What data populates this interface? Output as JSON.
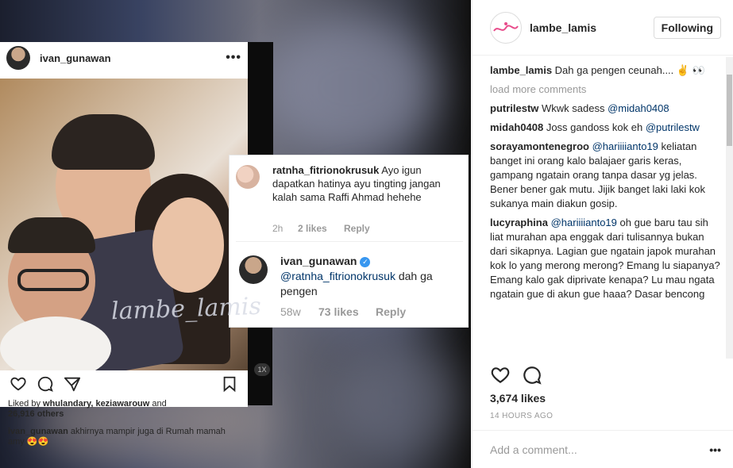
{
  "media": {
    "card": {
      "username": "ivan_gunawan",
      "more_icon": "more-dots-icon",
      "liked_by_prefix": "Liked by ",
      "liked_by_names": "whulandary, keziawarouw",
      "liked_by_and": " and",
      "liked_by_count": "26,916 others",
      "caption_user": "ivan_gunawan",
      "caption_text": " akhirnya mampir juga di Rumah mamah amy 😍😍"
    },
    "comment1": {
      "user": "ratnha_fitrionokrusuk",
      "text": " Ayo igun dapatkan hatinya ayu tingting jangan kalah sama Raffi Ahmad hehehe",
      "time": "2h",
      "likes": "2 likes",
      "reply": "Reply"
    },
    "comment2": {
      "user": "ivan_gunawan",
      "mention": "@ratnha_fitrionokrusuk",
      "text": " dah ga pengen",
      "time": "58w",
      "likes": "73 likes",
      "reply": "Reply"
    },
    "watermark": "lambe_lamis",
    "badge": "1X"
  },
  "panel": {
    "username": "lambe_lamis",
    "follow_label": "Following",
    "caption_user": "lambe_lamis",
    "caption_text": " Dah ga pengen ceunah.... ✌ 👀",
    "load_more": "load more comments",
    "comments": [
      {
        "user": "putrilestw",
        "pre": " Wkwk sadess ",
        "mention": "@midah0408",
        "post": ""
      },
      {
        "user": "midah0408",
        "pre": " Joss gandoss kok eh ",
        "mention": "@putrilestw",
        "post": ""
      },
      {
        "user": "sorayamontenegroo",
        "pre": " ",
        "mention": "@hariiiianto19",
        "post": " keliatan banget ini orang kalo balajaer garis keras, gampang ngatain orang tanpa dasar yg jelas. Bener bener gak mutu. Jijik banget laki laki kok sukanya main diakun gosip."
      },
      {
        "user": "lucyraphina",
        "pre": " ",
        "mention": "@hariiiianto19",
        "post": " oh gue baru tau sih liat murahan apa enggak dari tulisannya bukan dari sikapnya. Lagian gue ngatain japok murahan kok lo yang merong merong? Emang lu siapanya? Emang kalo gak diprivate kenapa? Lu mau ngata ngatain gue di akun gue haaa? Dasar bencong"
      }
    ],
    "likes": "3,674 likes",
    "time": "14 HOURS AGO",
    "add_comment_placeholder": "Add a comment...",
    "heart_icon": "heart-icon",
    "comment_icon": "comment-icon"
  }
}
